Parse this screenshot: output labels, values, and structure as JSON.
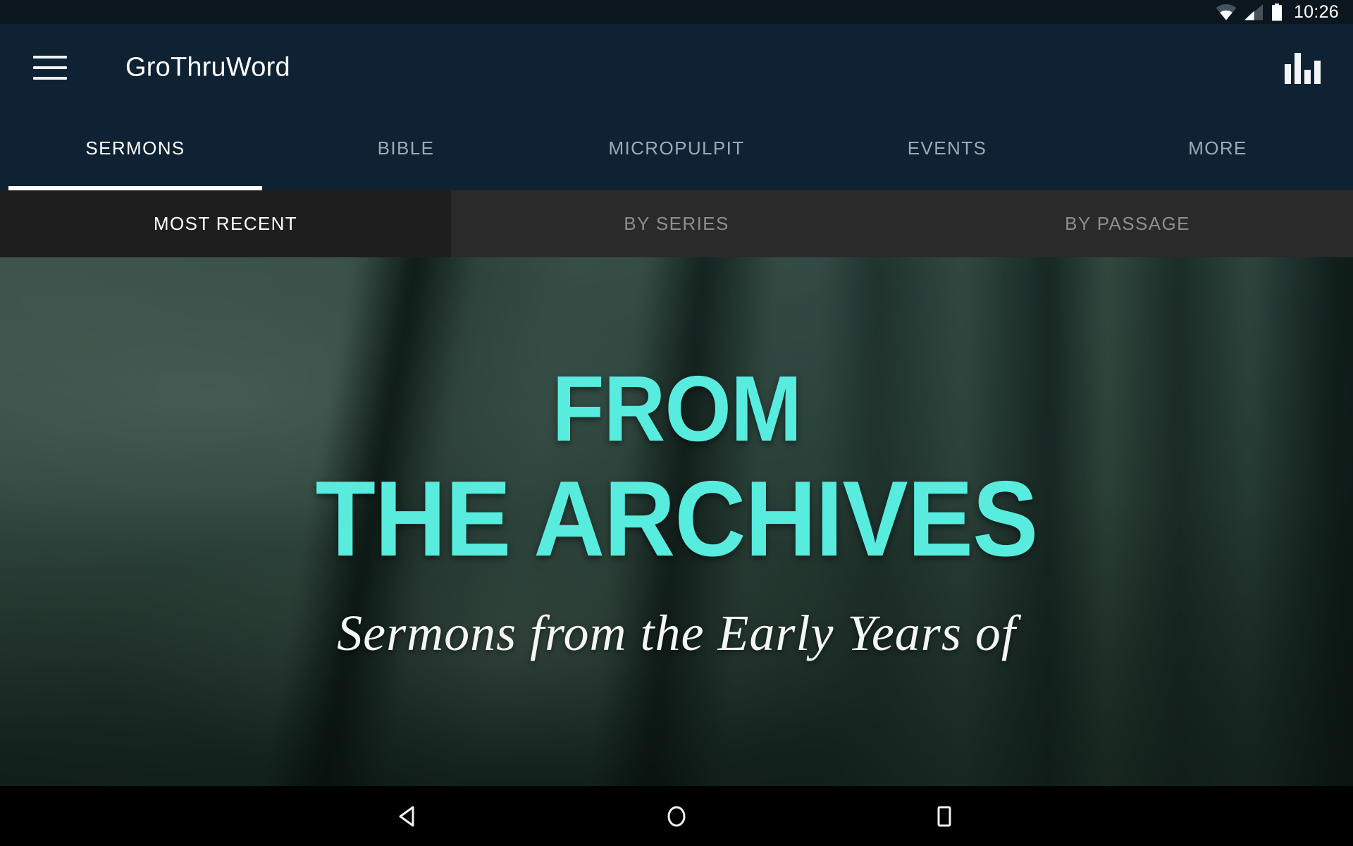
{
  "status_bar": {
    "time": "10:26",
    "icons": [
      "wifi-icon",
      "cellular-signal-icon",
      "battery-icon"
    ]
  },
  "app_bar": {
    "menu_icon": "hamburger-menu-icon",
    "title": "GroThruWord",
    "action_icon": "equalizer-icon"
  },
  "tabs": {
    "active_index": 0,
    "items": [
      {
        "label": "SERMONS"
      },
      {
        "label": "BIBLE"
      },
      {
        "label": "MICROPULPIT"
      },
      {
        "label": "EVENTS"
      },
      {
        "label": "MORE"
      }
    ]
  },
  "sub_tabs": {
    "active_index": 0,
    "items": [
      {
        "label": "MOST RECENT"
      },
      {
        "label": "BY SERIES"
      },
      {
        "label": "BY PASSAGE"
      }
    ]
  },
  "hero": {
    "title_line_1": "FROM",
    "title_line_2": "THE ARCHIVES",
    "subtitle": "Sermons from the Early Years of",
    "accent_color": "#58ecdf",
    "background_description": "blurred-bookshelf-photo"
  },
  "nav_bar": {
    "back_label": "back-button",
    "home_label": "home-button",
    "recents_label": "recents-button"
  },
  "theme": {
    "status_bar_bg": "#0c161e",
    "app_bar_bg": "#0f2233",
    "subtab_bg": "#2a2a2a",
    "subtab_active_bg": "#1e1e1e",
    "accent": "#58ecdf",
    "nav_bar_bg": "#000000"
  }
}
